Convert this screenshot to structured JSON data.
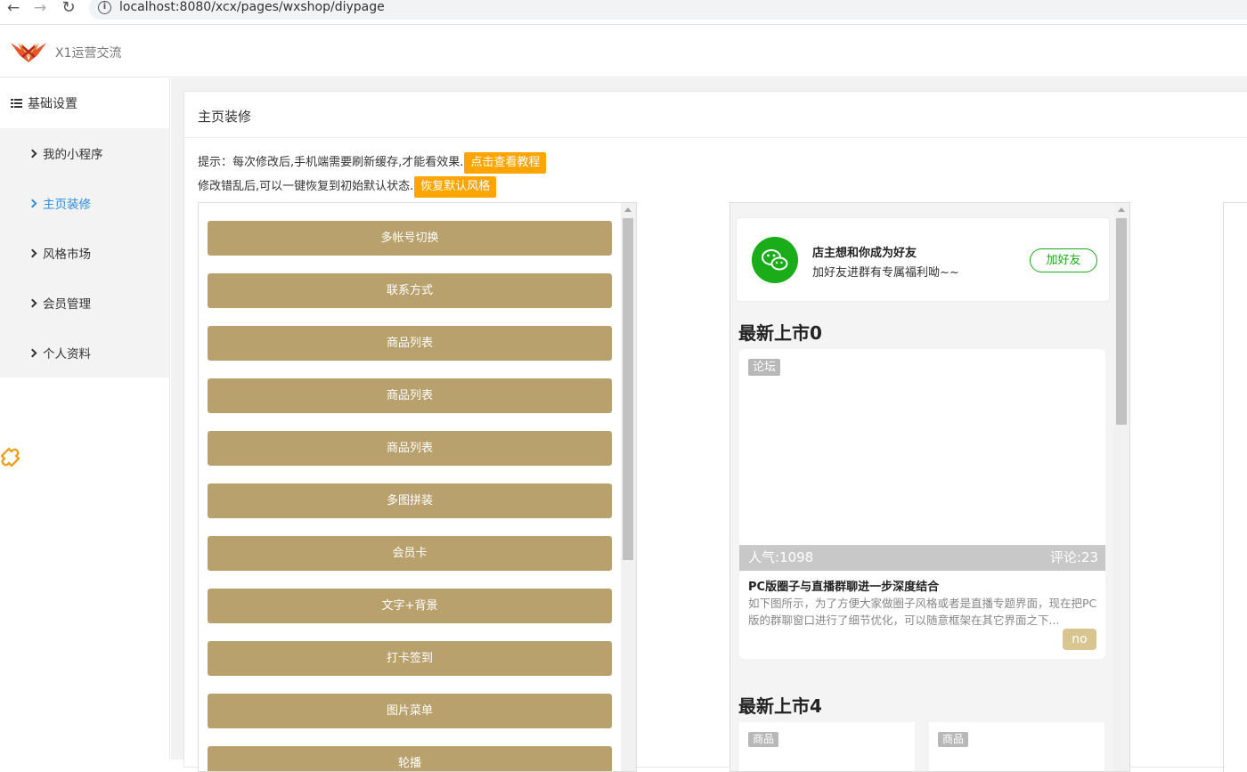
{
  "browser": {
    "url": "localhost:8080/xcx/pages/wxshop/diypage",
    "info_glyph": "i"
  },
  "header": {
    "logo_text": "X1运营交流"
  },
  "sidebar": {
    "section_label": "基础设置",
    "items": [
      {
        "label": "我的小程序",
        "active": false
      },
      {
        "label": "主页装修",
        "active": true
      },
      {
        "label": "风格市场",
        "active": false
      },
      {
        "label": "会员管理",
        "active": false
      },
      {
        "label": "个人资料",
        "active": false
      }
    ]
  },
  "main": {
    "title": "主页装修",
    "tip1_text": "提示：每次修改后,手机端需要刷新缓存,才能看效果.",
    "tip1_button": "点击查看教程",
    "tip2_text": "修改错乱后,可以一键恢复到初始默认状态.",
    "tip2_button": "恢复默认风格",
    "widgets": [
      "多帐号切换",
      "联系方式",
      "商品列表",
      "商品列表",
      "商品列表",
      "多图拼装",
      "会员卡",
      "文字+背景",
      "打卡签到",
      "图片菜单",
      "轮播"
    ]
  },
  "preview": {
    "friend_card": {
      "title": "店主想和你成为好友",
      "subtitle": "加好友进群有专属福利呦~~",
      "button": "加好友"
    },
    "section1_title": "最新上市0",
    "news": {
      "tag": "论坛",
      "views": "人气:1098",
      "comments": "评论:23",
      "title": "PC版圈子与直播群聊进一步深度结合",
      "desc": "如下图所示，为了方便大家做圈子风格或者是直播专题界面，现在把PC版的群聊窗口进行了细节优化，可以随意框架在其它界面之下...",
      "badge": "no"
    },
    "section2_title": "最新上市4",
    "goods_tags": [
      "商品",
      "商品"
    ]
  },
  "colors": {
    "widget_button": "#b9a16e",
    "tip_button": "#ffa500",
    "active_menu": "#2e8ede",
    "wechat_green": "#1aad19"
  },
  "icons": [
    "back-arrow-icon",
    "forward-arrow-icon",
    "reload-icon",
    "info-icon",
    "logo-icon",
    "list-icon",
    "chevron-right-icon",
    "puzzle-icon",
    "wechat-icon"
  ]
}
